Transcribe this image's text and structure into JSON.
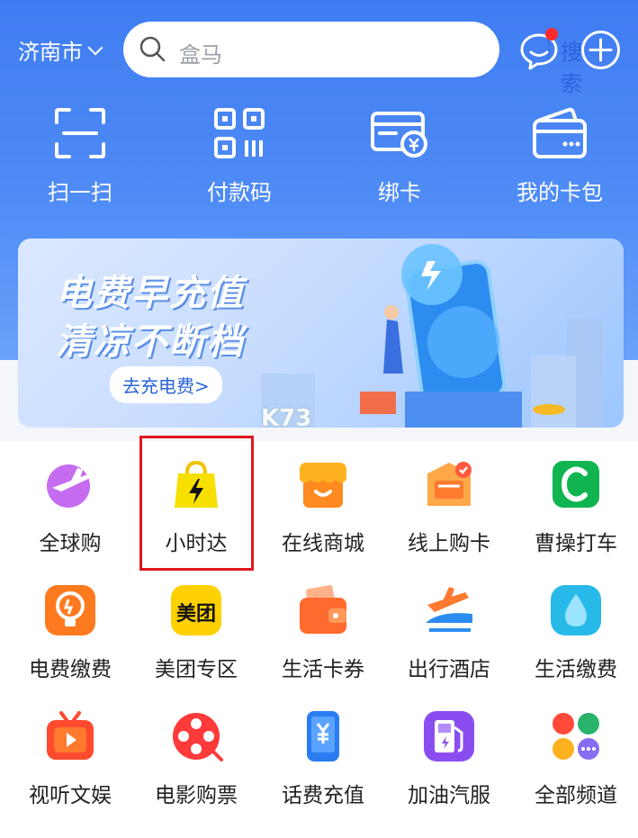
{
  "header": {
    "city": "济南市",
    "search_placeholder": "盒马",
    "search_button": "搜索"
  },
  "quick_actions": [
    {
      "label": "扫一扫",
      "icon": "scan-icon"
    },
    {
      "label": "付款码",
      "icon": "qr-code-icon"
    },
    {
      "label": "绑卡",
      "icon": "bind-card-icon"
    },
    {
      "label": "我的卡包",
      "icon": "wallet-icon"
    }
  ],
  "banner": {
    "line1": "电费早充值",
    "line2": "清凉不断档",
    "cta": "去充电费>"
  },
  "services": [
    {
      "label": "全球购",
      "icon": "global-shopping-icon"
    },
    {
      "label": "小时达",
      "icon": "shopping-bag-bolt-icon"
    },
    {
      "label": "在线商城",
      "icon": "store-icon"
    },
    {
      "label": "线上购卡",
      "icon": "gift-card-icon"
    },
    {
      "label": "曹操打车",
      "icon": "taxi-icon"
    },
    {
      "label": "电费缴费",
      "icon": "lightbulb-icon"
    },
    {
      "label": "美团专区",
      "icon": "meituan-icon",
      "badge_text": "美团"
    },
    {
      "label": "生活卡券",
      "icon": "coupon-wallet-icon"
    },
    {
      "label": "出行酒店",
      "icon": "travel-icon"
    },
    {
      "label": "生活缴费",
      "icon": "water-drop-icon"
    },
    {
      "label": "视听文娱",
      "icon": "tv-play-icon"
    },
    {
      "label": "电影购票",
      "icon": "film-reel-icon"
    },
    {
      "label": "话费充值",
      "icon": "phone-yuan-icon"
    },
    {
      "label": "加油汽服",
      "icon": "fuel-pump-icon"
    },
    {
      "label": "全部频道",
      "icon": "all-channels-icon"
    }
  ],
  "watermark": "K73",
  "colors": {
    "header_blue": "#3f7cf2",
    "accent_blue": "#2b63dc",
    "highlight_red": "#e0161e"
  }
}
